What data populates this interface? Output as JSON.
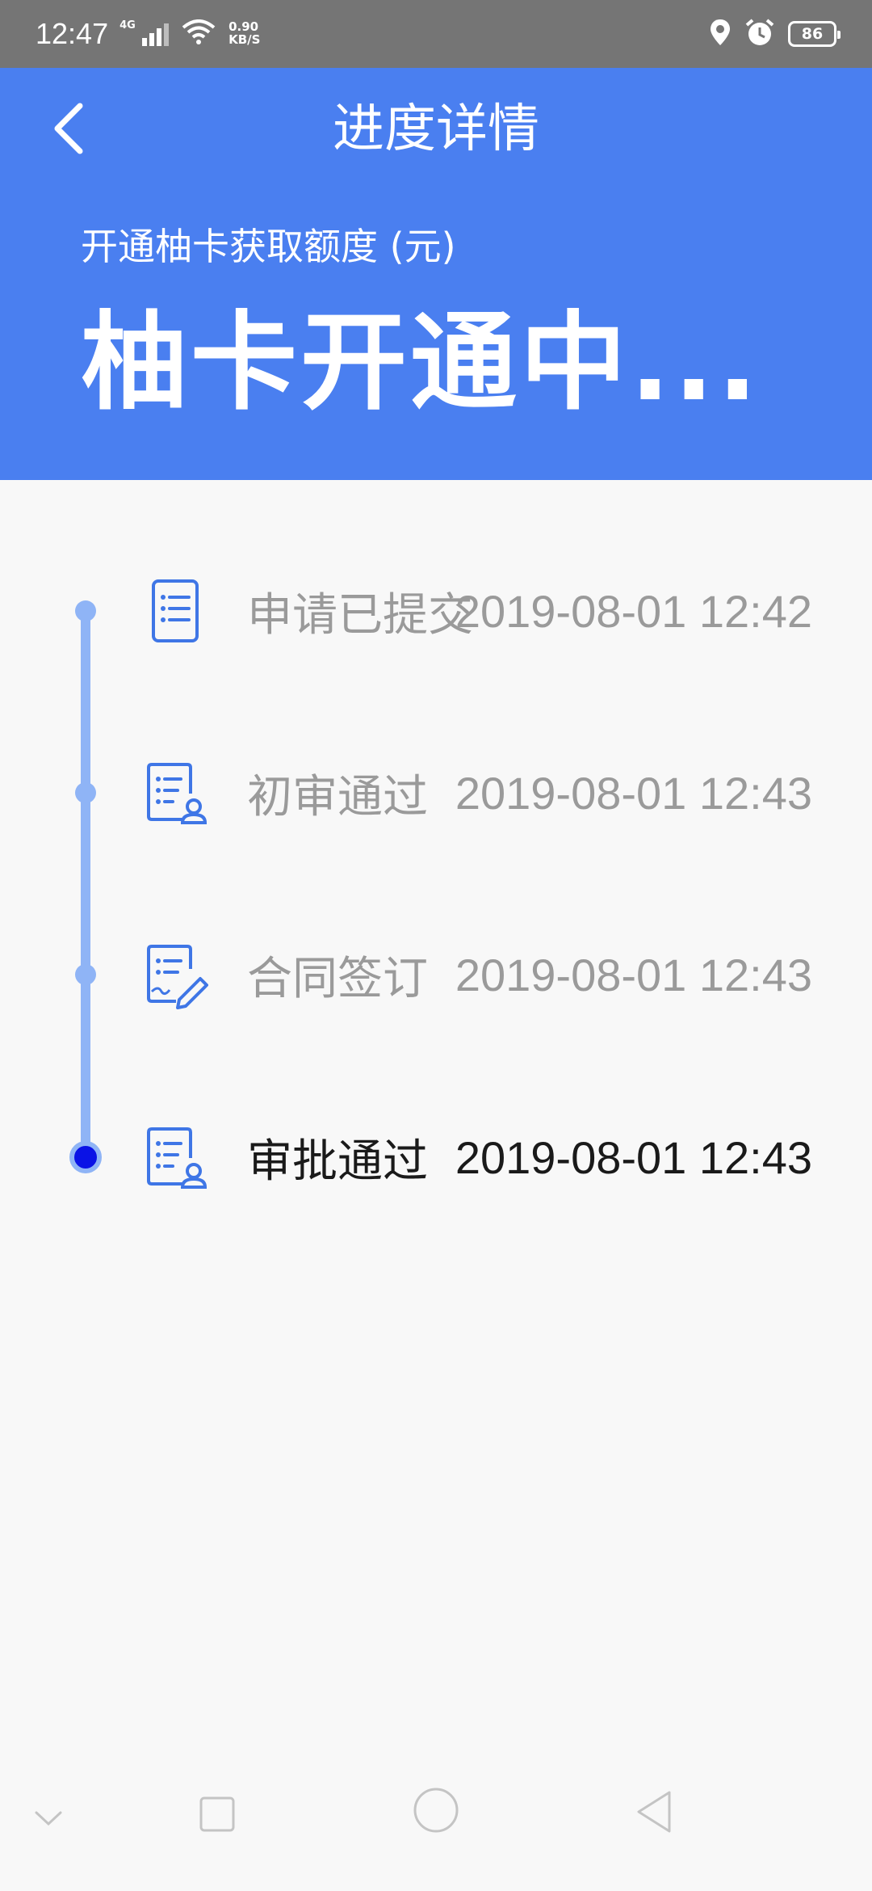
{
  "status_bar": {
    "time": "12:47",
    "network": "4G",
    "speed_value": "0.90",
    "speed_unit": "KB/S",
    "battery": "86"
  },
  "header": {
    "title": "进度详情",
    "subtitle": "开通柚卡获取额度 (元)",
    "status": "柚卡开通中..."
  },
  "timeline": {
    "steps": [
      {
        "label": "申请已提交",
        "time": "2019-08-01 12:42",
        "icon": "document-list-icon",
        "active": false
      },
      {
        "label": "初审通过",
        "time": "2019-08-01 12:43",
        "icon": "document-user-icon",
        "active": false
      },
      {
        "label": "合同签订",
        "time": "2019-08-01 12:43",
        "icon": "document-sign-icon",
        "active": false
      },
      {
        "label": "审批通过",
        "time": "2019-08-01 12:43",
        "icon": "document-user-icon",
        "active": true
      }
    ]
  },
  "colors": {
    "header_bg": "#4a7ff0",
    "track": "#8fb4f6",
    "active_dot": "#0a12e6",
    "icon_stroke": "#3f76e6"
  }
}
